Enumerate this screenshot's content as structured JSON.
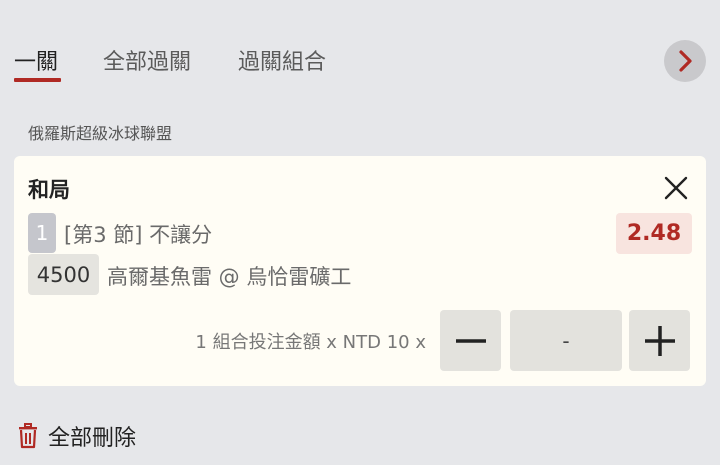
{
  "tabs": [
    {
      "label": "一關"
    },
    {
      "label": "全部過關"
    },
    {
      "label": "過關組合"
    }
  ],
  "league": "俄羅斯超級冰球聯盟",
  "bet": {
    "title": "和局",
    "period_badge": "1",
    "market": "[第3 節] 不讓分",
    "odds": "2.48",
    "event_id": "4500",
    "match": "高爾基魚雷 @ 烏恰雷礦工"
  },
  "stake": {
    "label": "1 組合投注金額 x NTD 10 x",
    "amount_value": "-"
  },
  "footer": {
    "delete_all_label": "全部刪除"
  },
  "colors": {
    "accent": "#b02a24",
    "background": "#e6e7ea",
    "card": "#fffdf5",
    "odds_bg": "#f8e4df"
  },
  "icons": {
    "next": "chevron-right-icon",
    "close": "close-icon",
    "minus": "minus-icon",
    "plus": "plus-icon",
    "trash": "trash-icon"
  }
}
